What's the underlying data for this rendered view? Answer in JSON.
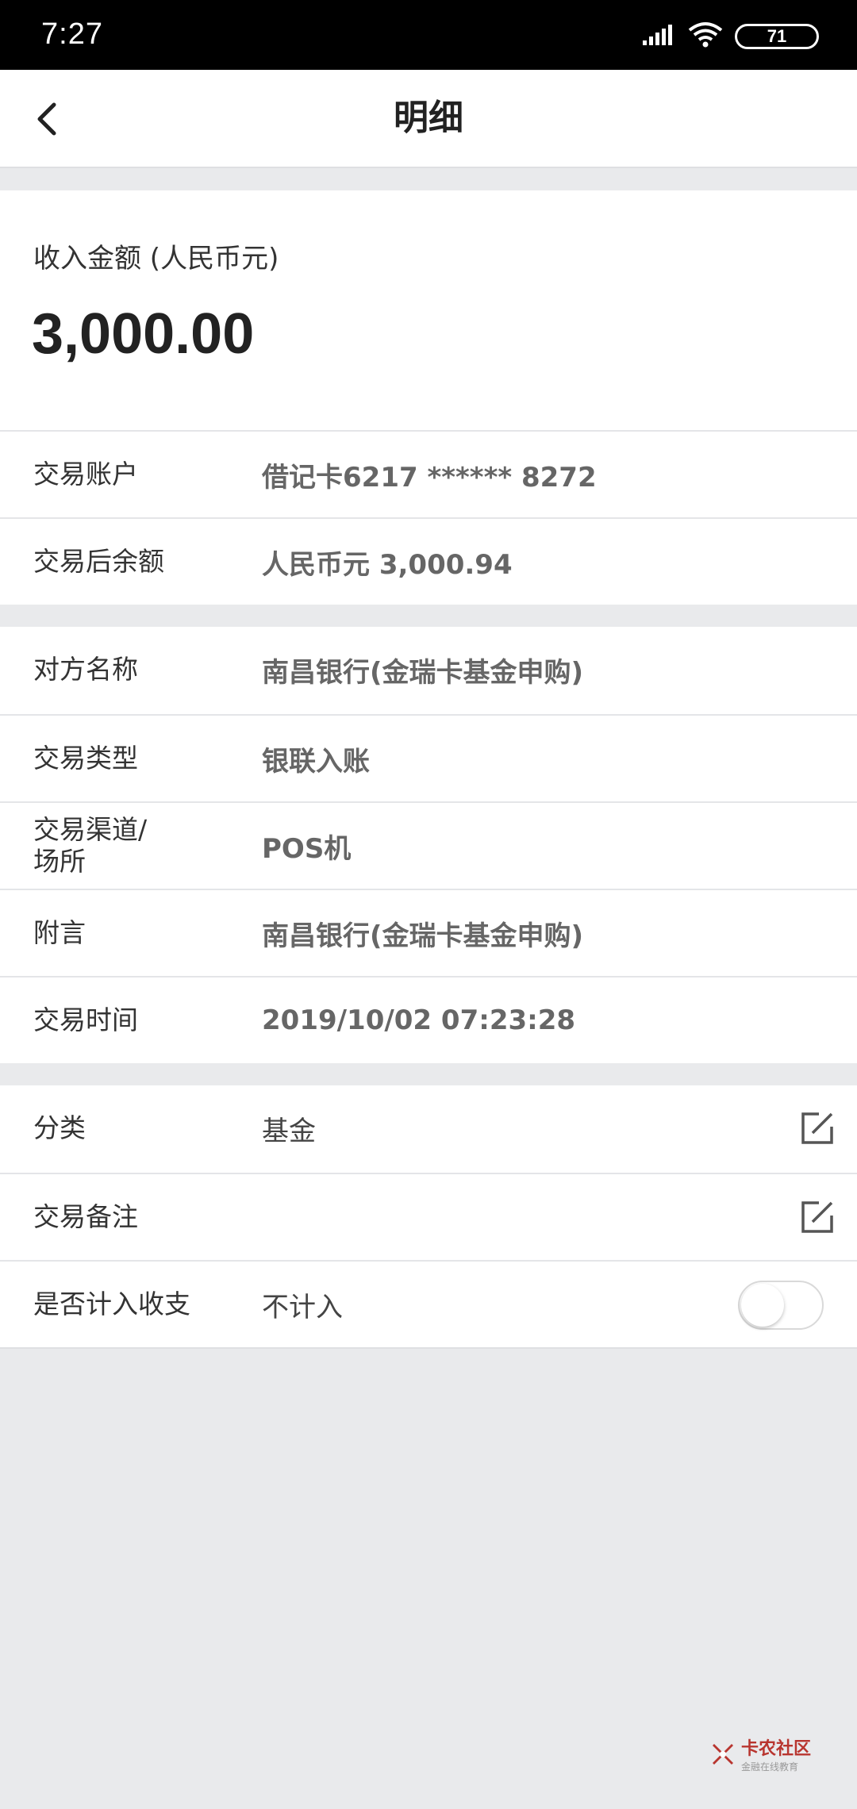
{
  "status_bar": {
    "time": "7:27",
    "battery": "71",
    "icons": [
      "signal-icon",
      "wifi-icon",
      "battery-icon"
    ]
  },
  "nav": {
    "title": "明细",
    "back_icon": "chevron-left-icon"
  },
  "amount": {
    "label": "收入金额 (人民币元)",
    "value": "3,000.00"
  },
  "account_section": [
    {
      "label": "交易账户",
      "value": "借记卡6217 ****** 8272"
    },
    {
      "label": "交易后余额",
      "value": "人民币元 3,000.94"
    }
  ],
  "detail_section": [
    {
      "label": "对方名称",
      "value": "南昌银行(金瑞卡基金申购)"
    },
    {
      "label": "交易类型",
      "value": "银联入账"
    },
    {
      "label": "交易渠道/\n场所",
      "value": "POS机"
    },
    {
      "label": "附言",
      "value": "南昌银行(金瑞卡基金申购)"
    },
    {
      "label": "交易时间",
      "value": "2019/10/02 07:23:28"
    }
  ],
  "category_section": {
    "category": {
      "label": "分类",
      "value": "基金",
      "icon": "edit-icon"
    },
    "note": {
      "label": "交易备注",
      "value": "",
      "icon": "edit-icon"
    },
    "include": {
      "label": "是否计入收支",
      "value": "不计入",
      "toggle_on": false
    }
  },
  "watermark": {
    "title": "卡农社区",
    "subtitle": "金融在线教育"
  },
  "colors": {
    "background": "#e9eaec",
    "card": "#ffffff",
    "label": "#333333",
    "value": "#666666",
    "watermark_accent": "#b8352f"
  }
}
